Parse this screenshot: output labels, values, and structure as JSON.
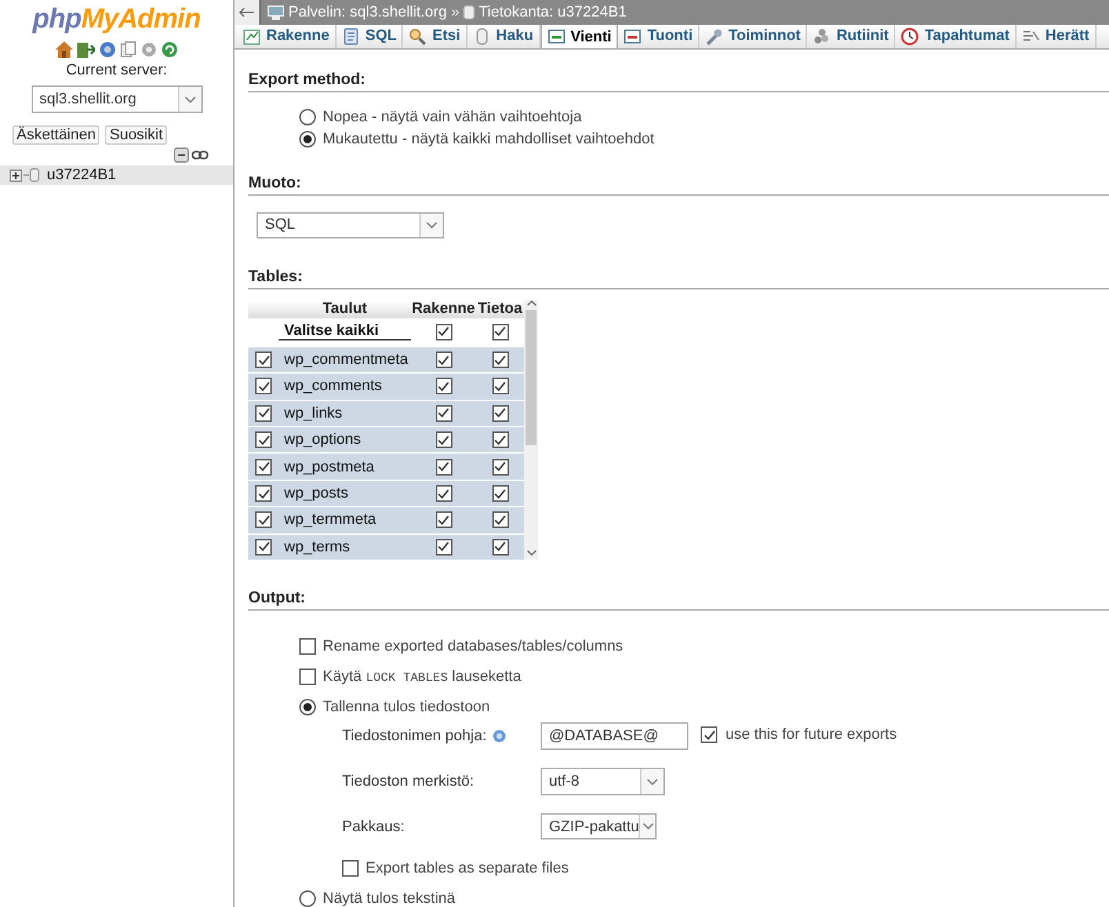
{
  "sidebar": {
    "logo": {
      "part1": "php",
      "part2": "MyAdmin"
    },
    "server_label": "Current server:",
    "server_select": {
      "value": "sql3.shellit.org"
    },
    "buttons": [
      "Äskettäinen",
      "Suosikit"
    ],
    "tree": [
      {
        "label": "u37224B1",
        "expanded": false
      }
    ]
  },
  "breadcrumb": {
    "server": "Palvelin: sql3.shellit.org",
    "separator": "»",
    "database": "Tietokanta: u37224B1"
  },
  "tabs": [
    {
      "label": "Rakenne",
      "kind": "structure",
      "selected": false
    },
    {
      "label": "SQL",
      "kind": "sql",
      "selected": false
    },
    {
      "label": "Etsi",
      "kind": "search",
      "selected": false
    },
    {
      "label": "Haku",
      "kind": "query",
      "selected": false
    },
    {
      "label": "Vienti",
      "kind": "export",
      "selected": true
    },
    {
      "label": "Tuonti",
      "kind": "import",
      "selected": false
    },
    {
      "label": "Toiminnot",
      "kind": "operations",
      "selected": false
    },
    {
      "label": "Rutiinit",
      "kind": "routines",
      "selected": false
    },
    {
      "label": "Tapahtumat",
      "kind": "events",
      "selected": false
    },
    {
      "label": "Herätt",
      "kind": "triggers",
      "selected": false
    }
  ],
  "export_method": {
    "heading": "Export method:",
    "options": [
      {
        "label": "Nopea - näytä vain vähän vaihtoehtoja",
        "selected": false
      },
      {
        "label": "Mukautettu - näytä kaikki mahdolliset vaihtoehdot",
        "selected": true
      }
    ]
  },
  "format": {
    "heading": "Muoto:",
    "select": {
      "value": "SQL"
    }
  },
  "tables": {
    "heading": "Tables:",
    "columns": [
      "Taulut",
      "Rakenne",
      "Tietoa"
    ],
    "select_all": {
      "label": "Valitse kaikki",
      "structure": true,
      "data": true
    },
    "rows": [
      {
        "name": "wp_commentmeta",
        "selected": true,
        "structure": true,
        "data": true
      },
      {
        "name": "wp_comments",
        "selected": true,
        "structure": true,
        "data": true
      },
      {
        "name": "wp_links",
        "selected": true,
        "structure": true,
        "data": true
      },
      {
        "name": "wp_options",
        "selected": true,
        "structure": true,
        "data": true
      },
      {
        "name": "wp_postmeta",
        "selected": true,
        "structure": true,
        "data": true
      },
      {
        "name": "wp_posts",
        "selected": true,
        "structure": true,
        "data": true
      },
      {
        "name": "wp_termmeta",
        "selected": true,
        "structure": true,
        "data": true
      },
      {
        "name": "wp_terms",
        "selected": true,
        "structure": true,
        "data": true
      }
    ]
  },
  "output": {
    "heading": "Output:",
    "options": [
      {
        "kind": "checkbox",
        "checked": false,
        "text": "Rename exported databases/tables/columns"
      },
      {
        "kind": "checkbox",
        "checked": false,
        "text": "Käytä ",
        "code": "LOCK TABLES",
        "text_after": " lauseketta"
      },
      {
        "kind": "radio",
        "selected": true,
        "text": "Tallenna tulos tiedostoon"
      }
    ],
    "file_options": {
      "template_label": "Tiedostonimen pohja:",
      "template_value": "@DATABASE@",
      "remember": {
        "checked": true,
        "text": "use this for future exports"
      },
      "charset_label": "Tiedoston merkistö:",
      "charset_value": "utf-8",
      "compression_label": "Pakkaus:",
      "compression_value": "GZIP-pakattu",
      "separate": {
        "checked": false,
        "text": "Export tables as separate files"
      }
    },
    "text_option": {
      "selected": false,
      "text": "Näytä tulos tekstinä"
    }
  }
}
